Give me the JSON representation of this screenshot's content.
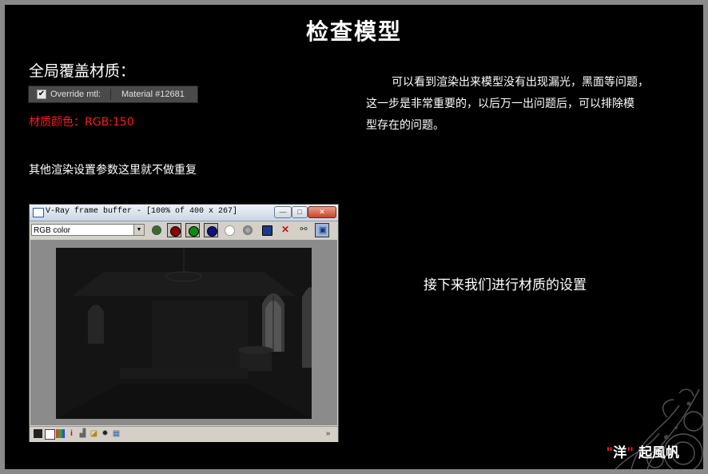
{
  "title": "检查模型",
  "left": {
    "section_label": "全局覆盖材质：",
    "override": {
      "checkbox_checked": true,
      "label": "Override mtl:",
      "material": "Material #12681"
    },
    "color_note": "材质颜色：RGB:150",
    "other_note": "其他渲染设置参数这里就不做重复"
  },
  "right": {
    "paragraph_lines": [
      "可以看到渲染出来模型没有出现漏光，黑面等问题，",
      "这一步是非常重要的，以后万一出问题后，可以排除模",
      "型存在的问题。"
    ],
    "next_note": "接下来我们进行材质的设置"
  },
  "signature": {
    "open_quote": "\"",
    "name_char": "洋",
    "close_quote": "\"",
    "rest": "起風帆"
  },
  "vfb": {
    "title": "V-Ray frame buffer - [100% of 400 x 267]",
    "channel_value": "RGB color",
    "window_buttons": {
      "minimize": "—",
      "maximize": "□",
      "close": "✕"
    },
    "toolbar_icons": [
      {
        "name": "rgb-channel-icon",
        "color": "#6a6a6a"
      },
      {
        "name": "red-channel-icon",
        "color": "#8b0000"
      },
      {
        "name": "green-channel-icon",
        "color": "#108a10"
      },
      {
        "name": "blue-channel-icon",
        "color": "#101080"
      },
      {
        "name": "alpha-channel-icon",
        "color": "#ffffff"
      },
      {
        "name": "mono-channel-icon",
        "color": "#777777"
      }
    ],
    "save_glyph": "💾",
    "clear_glyph": "✕",
    "statusbar_expand": "»"
  }
}
